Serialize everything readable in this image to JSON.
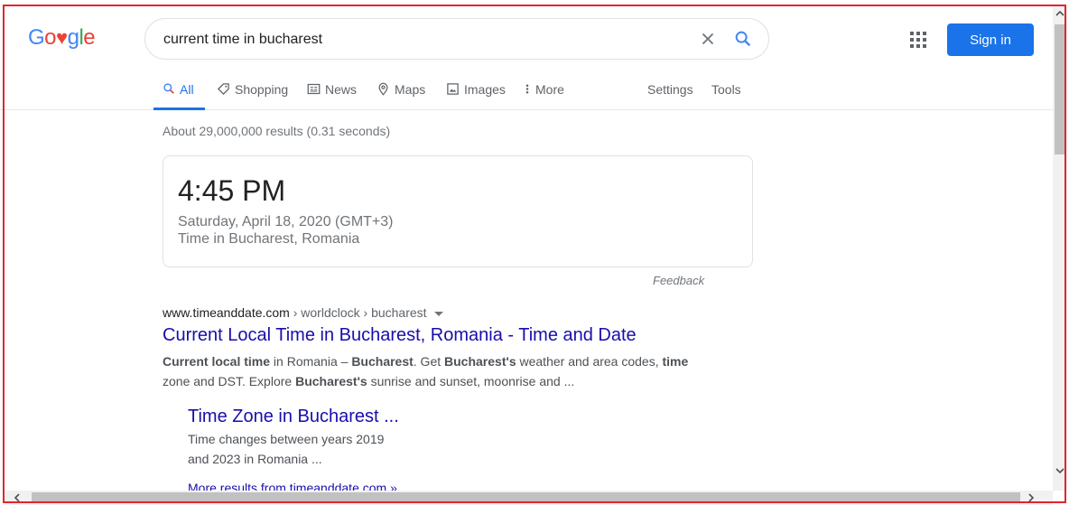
{
  "header": {
    "logo_text": "Google",
    "search_query": "current time in bucharest",
    "signin_label": "Sign in"
  },
  "tabs": [
    {
      "label": "All",
      "icon": "search-icon",
      "active": true
    },
    {
      "label": "Shopping",
      "icon": "tag-icon"
    },
    {
      "label": "News",
      "icon": "news-icon"
    },
    {
      "label": "Maps",
      "icon": "map-pin-icon"
    },
    {
      "label": "Images",
      "icon": "image-icon"
    },
    {
      "label": "More",
      "icon": "more-vert-icon"
    },
    {
      "label": "Settings"
    },
    {
      "label": "Tools"
    }
  ],
  "result_stats": "About 29,000,000 results (0.31 seconds)",
  "time_card": {
    "time": "4:45 PM",
    "date": "Saturday, April 18, 2020 (GMT+3)",
    "place": "Time in Bucharest, Romania",
    "feedback": "Feedback"
  },
  "result": {
    "domain": "www.timeanddate.com",
    "path": " › worldclock › bucharest",
    "title": "Current Local Time in Bucharest, Romania - Time and Date",
    "snippet_parts": [
      {
        "text": "Current local time",
        "bold": true
      },
      {
        "text": " in Romania – ",
        "bold": false
      },
      {
        "text": "Bucharest",
        "bold": true
      },
      {
        "text": ". Get ",
        "bold": false
      },
      {
        "text": "Bucharest's",
        "bold": true
      },
      {
        "text": " weather and area codes, ",
        "bold": false
      },
      {
        "text": "time",
        "bold": true
      },
      {
        "text": " zone and DST. Explore ",
        "bold": false
      },
      {
        "text": "Bucharest's",
        "bold": true
      },
      {
        "text": " sunrise and sunset, moonrise and ...",
        "bold": false
      }
    ],
    "sub_title": "Time Zone in Bucharest ...",
    "sub_snippet": "Time changes between years 2019 and 2023 in Romania ...",
    "more_results": "More results from timeanddate.com »"
  },
  "colors": {
    "accent": "#1a73e8",
    "link": "#1a0dab",
    "frame": "#e0262f"
  }
}
